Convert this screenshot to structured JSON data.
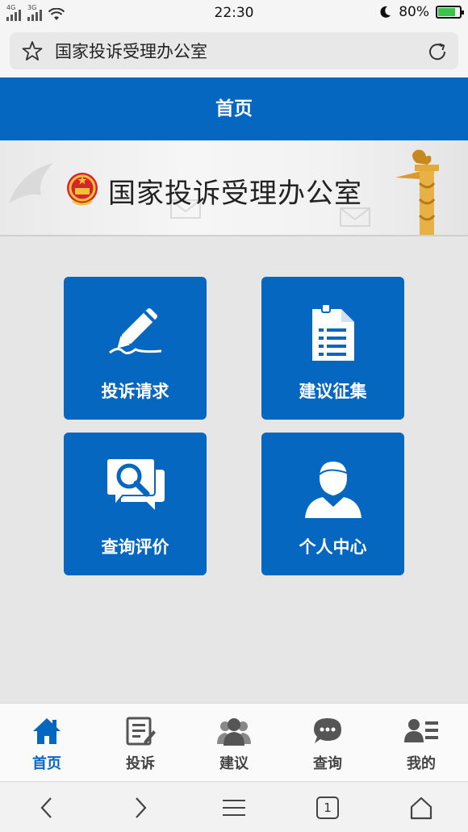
{
  "status_bar": {
    "signal1_label": "4G",
    "signal2_label": "3G",
    "time": "22:30",
    "battery_percent": "80%",
    "battery_level": 0.8,
    "charging": true
  },
  "browser": {
    "url_title": "国家投诉受理办公室",
    "tab_count": "1"
  },
  "header": {
    "title": "首页"
  },
  "banner": {
    "title": "国家投诉受理办公室"
  },
  "tiles": [
    {
      "label": "投诉请求",
      "icon": "pen-icon"
    },
    {
      "label": "建议征集",
      "icon": "document-icon"
    },
    {
      "label": "查询评价",
      "icon": "search-chat-icon"
    },
    {
      "label": "个人中心",
      "icon": "user-icon"
    }
  ],
  "bottom_nav": [
    {
      "label": "首页",
      "icon": "home-icon",
      "active": true
    },
    {
      "label": "投诉",
      "icon": "edit-icon",
      "active": false
    },
    {
      "label": "建议",
      "icon": "group-icon",
      "active": false
    },
    {
      "label": "查询",
      "icon": "chat-icon",
      "active": false
    },
    {
      "label": "我的",
      "icon": "profile-list-icon",
      "active": false
    }
  ],
  "colors": {
    "primary": "#0667c0",
    "background": "#e6e6e6",
    "inactive_nav": "#666666"
  }
}
